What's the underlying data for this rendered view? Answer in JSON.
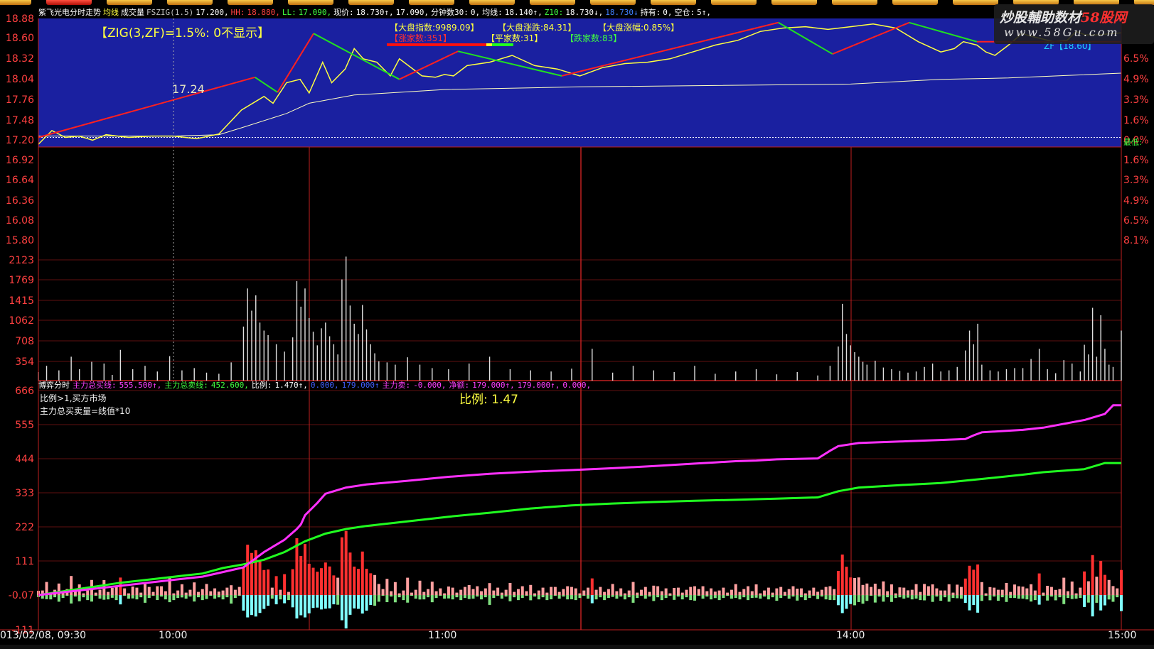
{
  "toolbar": {
    "button_count": 20,
    "active_index": 1
  },
  "info_bar": [
    {
      "text": "紫飞光电分时走势",
      "color": "#ffffff"
    },
    {
      "text": "均线",
      "color": "#ffff40"
    },
    {
      "text": "成交量",
      "color": "#ffffff"
    },
    {
      "text": "FSZIG(1.5)",
      "color": "#c0c0c0"
    },
    {
      "text": "17.200,",
      "color": "#ffffff"
    },
    {
      "text": "HH:",
      "color": "#ff4040"
    },
    {
      "text": "18.880,",
      "color": "#ff4040"
    },
    {
      "text": "LL:",
      "color": "#40ff40"
    },
    {
      "text": "17.090,",
      "color": "#40ff40"
    },
    {
      "text": "现价:",
      "color": "#ffffff"
    },
    {
      "text": "18.730↑,",
      "color": "#ffffff"
    },
    {
      "text": "17.090,",
      "color": "#ffffff"
    },
    {
      "text": "分钟数30:",
      "color": "#ffffff"
    },
    {
      "text": "0,",
      "color": "#ffffff"
    },
    {
      "text": "均线:",
      "color": "#ffffff"
    },
    {
      "text": "18.140↑,",
      "color": "#ffffff"
    },
    {
      "text": "Z10:",
      "color": "#40ff40"
    },
    {
      "text": "18.730↓,",
      "color": "#ffffff"
    },
    {
      "text": "18.730↓",
      "color": "#4080ff"
    },
    {
      "text": "持有:",
      "color": "#ffffff"
    },
    {
      "text": "0,",
      "color": "#ffffff"
    },
    {
      "text": "空仓:",
      "color": "#ffffff"
    },
    {
      "text": "5↑,",
      "color": "#ffffff"
    }
  ],
  "labels": {
    "zig": "【ZIG(3,ZF)=1.5%:   0不显示】",
    "low_price": "17.24",
    "market_index": "【大盘指数:9989.09】",
    "market_change": "【大盘涨跌:84.31】",
    "market_pct": "【大盘涨幅:0.85%】",
    "up_count": "【涨家数:351】",
    "flat_count": "【平家数:31】",
    "down_count": "【跌家数:83】",
    "zf": "ZF【18.60】",
    "ratio": "比例: 1.47",
    "note1": "比例>1,买方市场",
    "note2": "主力总买卖量=线值*10",
    "cut": "最低:"
  },
  "watermark": {
    "line1a": "炒股輔助数材",
    "line1b": "58股网",
    "line2": "www.58Gu.com"
  },
  "indicator_bar": [
    {
      "text": "博弈分时",
      "color": "#ffffff"
    },
    {
      "text": "主力总买线:",
      "color": "#ff40ff"
    },
    {
      "text": "555.500↑,",
      "color": "#ff40ff"
    },
    {
      "text": "主力总卖线:",
      "color": "#40ff40"
    },
    {
      "text": "452.600,",
      "color": "#40ff40"
    },
    {
      "text": "比例:",
      "color": "#ffffff"
    },
    {
      "text": "1.470↑,",
      "color": "#ffffff"
    },
    {
      "text": "0.000,",
      "color": "#4060ff"
    },
    {
      "text": "179.000↑",
      "color": "#4060ff"
    },
    {
      "text": "主力卖:",
      "color": "#ff40ff"
    },
    {
      "text": "-0.000,",
      "color": "#ff40ff"
    },
    {
      "text": "净额:",
      "color": "#ff40ff"
    },
    {
      "text": "179.000↑,",
      "color": "#ff40ff"
    },
    {
      "text": "179.000↑,",
      "color": "#ff40ff"
    },
    {
      "text": "0.000,",
      "color": "#ff40ff"
    }
  ],
  "axes": {
    "price_ticks": [
      "18.88",
      "18.60",
      "18.32",
      "18.04",
      "17.76",
      "17.48",
      "17.20",
      "16.92",
      "16.64",
      "16.36",
      "16.08",
      "15.80"
    ],
    "pct_ticks": [
      "6.5%",
      "4.9%",
      "3.3%",
      "1.6%",
      "0.0%",
      "1.6%",
      "3.3%",
      "4.9%",
      "6.5%",
      "8.1%"
    ],
    "volume_ticks": [
      "2123",
      "1769",
      "1415",
      "1062",
      "708",
      "354"
    ],
    "ind_ticks": [
      "666",
      "555",
      "444",
      "333",
      "222",
      "111",
      "-0.07",
      "-111"
    ],
    "time_labels": [
      "013/02/08, 09:30",
      "10:00",
      "11:00",
      "14:00",
      "15:00"
    ]
  },
  "chart_data": {
    "type": "line",
    "title": "紫飞光电分时走势",
    "x_axis": "time 09:30-15:00 (240 minutes)",
    "price": {
      "prev_close": 17.2,
      "ylim": [
        15.8,
        18.88
      ],
      "x_minutes": [
        0,
        3,
        6,
        9,
        12,
        15,
        20,
        25,
        30,
        35,
        40,
        45,
        50,
        52,
        55,
        58,
        60,
        63,
        65,
        68,
        70,
        72,
        75,
        78,
        80,
        82,
        85,
        88,
        90,
        92,
        95,
        100,
        105,
        110,
        115,
        120,
        125,
        130,
        135,
        140,
        145,
        150,
        155,
        160,
        165,
        170,
        175,
        180,
        185,
        190,
        195,
        200,
        203,
        205,
        208,
        210,
        212,
        215,
        218,
        220,
        225,
        228,
        230,
        232,
        235,
        238,
        240
      ],
      "price": [
        17.1,
        17.3,
        17.2,
        17.22,
        17.16,
        17.24,
        17.2,
        17.22,
        17.22,
        17.18,
        17.25,
        17.6,
        17.8,
        17.7,
        18.0,
        18.05,
        17.85,
        18.3,
        18.0,
        18.2,
        18.5,
        18.35,
        18.3,
        18.1,
        18.35,
        18.25,
        18.1,
        18.08,
        18.12,
        18.1,
        18.25,
        18.3,
        18.4,
        18.25,
        18.2,
        18.1,
        18.22,
        18.28,
        18.3,
        18.35,
        18.45,
        18.55,
        18.62,
        18.75,
        18.8,
        18.82,
        18.78,
        18.82,
        18.86,
        18.8,
        18.6,
        18.45,
        18.5,
        18.6,
        18.55,
        18.45,
        18.4,
        18.55,
        18.72,
        18.68,
        18.6,
        18.62,
        18.75,
        18.7,
        18.7,
        18.72,
        18.73
      ],
      "avg_x": [
        0,
        30,
        40,
        45,
        55,
        60,
        70,
        80,
        90,
        120,
        150,
        180,
        200,
        215,
        240
      ],
      "avg": [
        17.22,
        17.22,
        17.24,
        17.34,
        17.55,
        17.7,
        17.82,
        17.86,
        17.9,
        17.94,
        17.96,
        17.98,
        18.05,
        18.07,
        18.14
      ],
      "zig_x": [
        0,
        48,
        53,
        61,
        80,
        93,
        116,
        164,
        176,
        193,
        208,
        224,
        240
      ],
      "zig": [
        17.2,
        18.08,
        17.86,
        18.72,
        18.05,
        18.46,
        18.1,
        18.88,
        18.42,
        18.88,
        18.6,
        18.6,
        18.6
      ]
    },
    "volume": {
      "ylim": [
        0,
        2300
      ],
      "bars": [
        [
          0,
          150
        ],
        [
          2,
          260
        ],
        [
          5,
          180
        ],
        [
          8,
          420
        ],
        [
          10,
          200
        ],
        [
          13,
          330
        ],
        [
          16,
          300
        ],
        [
          18,
          100
        ],
        [
          20,
          540
        ],
        [
          23,
          200
        ],
        [
          26,
          260
        ],
        [
          29,
          160
        ],
        [
          32,
          430
        ],
        [
          35,
          180
        ],
        [
          38,
          220
        ],
        [
          41,
          140
        ],
        [
          44,
          120
        ],
        [
          47,
          320
        ],
        [
          50,
          950
        ],
        [
          51,
          1620
        ],
        [
          52,
          1230
        ],
        [
          53,
          1500
        ],
        [
          54,
          1020
        ],
        [
          55,
          880
        ],
        [
          56,
          800
        ],
        [
          58,
          640
        ],
        [
          60,
          510
        ],
        [
          62,
          760
        ],
        [
          63,
          1750
        ],
        [
          64,
          1300
        ],
        [
          65,
          1620
        ],
        [
          66,
          1100
        ],
        [
          67,
          860
        ],
        [
          68,
          620
        ],
        [
          69,
          920
        ],
        [
          70,
          1020
        ],
        [
          71,
          780
        ],
        [
          72,
          640
        ],
        [
          73,
          460
        ],
        [
          74,
          1780
        ],
        [
          75,
          2180
        ],
        [
          76,
          1320
        ],
        [
          77,
          1000
        ],
        [
          78,
          820
        ],
        [
          79,
          1330
        ],
        [
          80,
          900
        ],
        [
          81,
          640
        ],
        [
          82,
          480
        ],
        [
          83,
          340
        ],
        [
          85,
          320
        ],
        [
          87,
          280
        ],
        [
          90,
          410
        ],
        [
          93,
          280
        ],
        [
          96,
          220
        ],
        [
          100,
          200
        ],
        [
          105,
          300
        ],
        [
          110,
          420
        ],
        [
          115,
          200
        ],
        [
          120,
          180
        ],
        [
          125,
          160
        ],
        [
          130,
          210
        ],
        [
          135,
          560
        ],
        [
          140,
          140
        ],
        [
          145,
          260
        ],
        [
          150,
          180
        ],
        [
          155,
          150
        ],
        [
          160,
          260
        ],
        [
          165,
          120
        ],
        [
          170,
          160
        ],
        [
          175,
          200
        ],
        [
          180,
          110
        ],
        [
          185,
          150
        ],
        [
          190,
          90
        ],
        [
          193,
          260
        ],
        [
          195,
          600
        ],
        [
          196,
          1350
        ],
        [
          197,
          820
        ],
        [
          198,
          620
        ],
        [
          199,
          500
        ],
        [
          200,
          420
        ],
        [
          201,
          330
        ],
        [
          202,
          280
        ],
        [
          204,
          350
        ],
        [
          206,
          230
        ],
        [
          208,
          200
        ],
        [
          210,
          170
        ],
        [
          212,
          140
        ],
        [
          214,
          160
        ],
        [
          216,
          240
        ],
        [
          218,
          300
        ],
        [
          220,
          160
        ],
        [
          222,
          180
        ],
        [
          224,
          240
        ],
        [
          226,
          530
        ],
        [
          227,
          880
        ],
        [
          228,
          640
        ],
        [
          229,
          1000
        ],
        [
          230,
          280
        ],
        [
          232,
          180
        ],
        [
          234,
          160
        ],
        [
          236,
          200
        ],
        [
          238,
          220
        ],
        [
          240,
          220
        ],
        [
          242,
          380
        ],
        [
          244,
          560
        ],
        [
          246,
          200
        ],
        [
          248,
          130
        ],
        [
          250,
          360
        ],
        [
          252,
          300
        ],
        [
          254,
          160
        ],
        [
          255,
          630
        ],
        [
          256,
          460
        ],
        [
          257,
          1280
        ],
        [
          258,
          420
        ],
        [
          259,
          1150
        ],
        [
          260,
          560
        ],
        [
          261,
          280
        ],
        [
          262,
          240
        ],
        [
          264,
          880
        ]
      ]
    },
    "indicator": {
      "ylim": [
        -111,
        666
      ],
      "buy_x": [
        0,
        10,
        20,
        30,
        40,
        45,
        50,
        52,
        55,
        60,
        63,
        64,
        65,
        68,
        70,
        73,
        75,
        80,
        90,
        100,
        110,
        120,
        130,
        140,
        150,
        160,
        165,
        170,
        175,
        180,
        190,
        193,
        195,
        200,
        210,
        220,
        226,
        228,
        230,
        240,
        245,
        255,
        260,
        262,
        264
      ],
      "buy_line": [
        0,
        15,
        30,
        45,
        60,
        75,
        90,
        110,
        140,
        180,
        215,
        230,
        260,
        300,
        330,
        342,
        350,
        360,
        372,
        385,
        395,
        402,
        407,
        413,
        420,
        428,
        432,
        436,
        438,
        442,
        445,
        470,
        485,
        495,
        500,
        505,
        508,
        520,
        530,
        538,
        545,
        570,
        590,
        618,
        618
      ],
      "sell_x": [
        0,
        10,
        20,
        30,
        40,
        45,
        50,
        55,
        60,
        65,
        70,
        75,
        80,
        90,
        100,
        110,
        120,
        130,
        140,
        150,
        160,
        170,
        180,
        190,
        195,
        200,
        210,
        220,
        230,
        240,
        245,
        255,
        260,
        264
      ],
      "sell_line": [
        0,
        20,
        40,
        55,
        70,
        88,
        100,
        115,
        140,
        175,
        200,
        215,
        225,
        240,
        255,
        268,
        282,
        292,
        298,
        303,
        307,
        310,
        314,
        318,
        338,
        350,
        358,
        365,
        378,
        392,
        400,
        410,
        430,
        430
      ]
    }
  }
}
